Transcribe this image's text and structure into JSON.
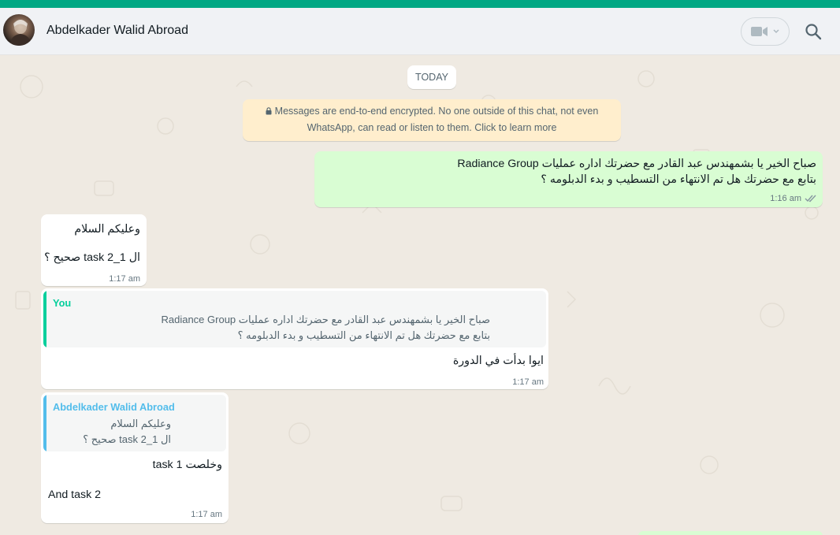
{
  "colors": {
    "accent": "#00a884",
    "outgoing_bubble": "#d9fdd3",
    "incoming_bubble": "#ffffff",
    "notice_bg": "#ffeecd",
    "quote_you": "#06cf9c",
    "quote_contact": "#53bdeb"
  },
  "header": {
    "contact_name": "Abdelkader Walid Abroad",
    "video_icon": "video-camera-icon",
    "search_icon": "search-icon"
  },
  "chat": {
    "date_label": "TODAY",
    "encryption_notice": {
      "line1": "Messages are end-to-end encrypted. No one outside of this chat, not even",
      "line2": "WhatsApp, can read or listen to them. Click to learn more"
    },
    "messages": [
      {
        "direction": "out",
        "lines": [
          "صباح الخير يا بشمهندس عبد القادر  مع  حضرتك اداره عمليات Radiance Group",
          "بتابع مع حضرتك هل تم الانتهاء من التسطيب و بدء الدبلومه ؟"
        ],
        "time": "1:16 am",
        "status": "read"
      },
      {
        "direction": "in",
        "lines": [
          "وعليكم السلام",
          "",
          "ال 1_2 task صحيح ؟"
        ],
        "time": "1:17 am"
      },
      {
        "direction": "in",
        "quote": {
          "author": "You",
          "lines": [
            "صباح الخير يا بشمهندس عبد القادر  مع  حضرتك اداره عمليات Radiance Group",
            "بتابع مع حضرتك هل تم الانتهاء من التسطيب و بدء الدبلومه ؟"
          ]
        },
        "lines": [
          "ايوا بدأت في الدورة"
        ],
        "time": "1:17 am"
      },
      {
        "direction": "in",
        "quote": {
          "author": "Abdelkader Walid Abroad",
          "lines": [
            "وعليكم السلام",
            "ال 1_2 task صحيح ؟"
          ]
        },
        "lines": [
          "وخلصت 1 task",
          "",
          "And task 2"
        ],
        "time": "1:17 am"
      }
    ]
  }
}
